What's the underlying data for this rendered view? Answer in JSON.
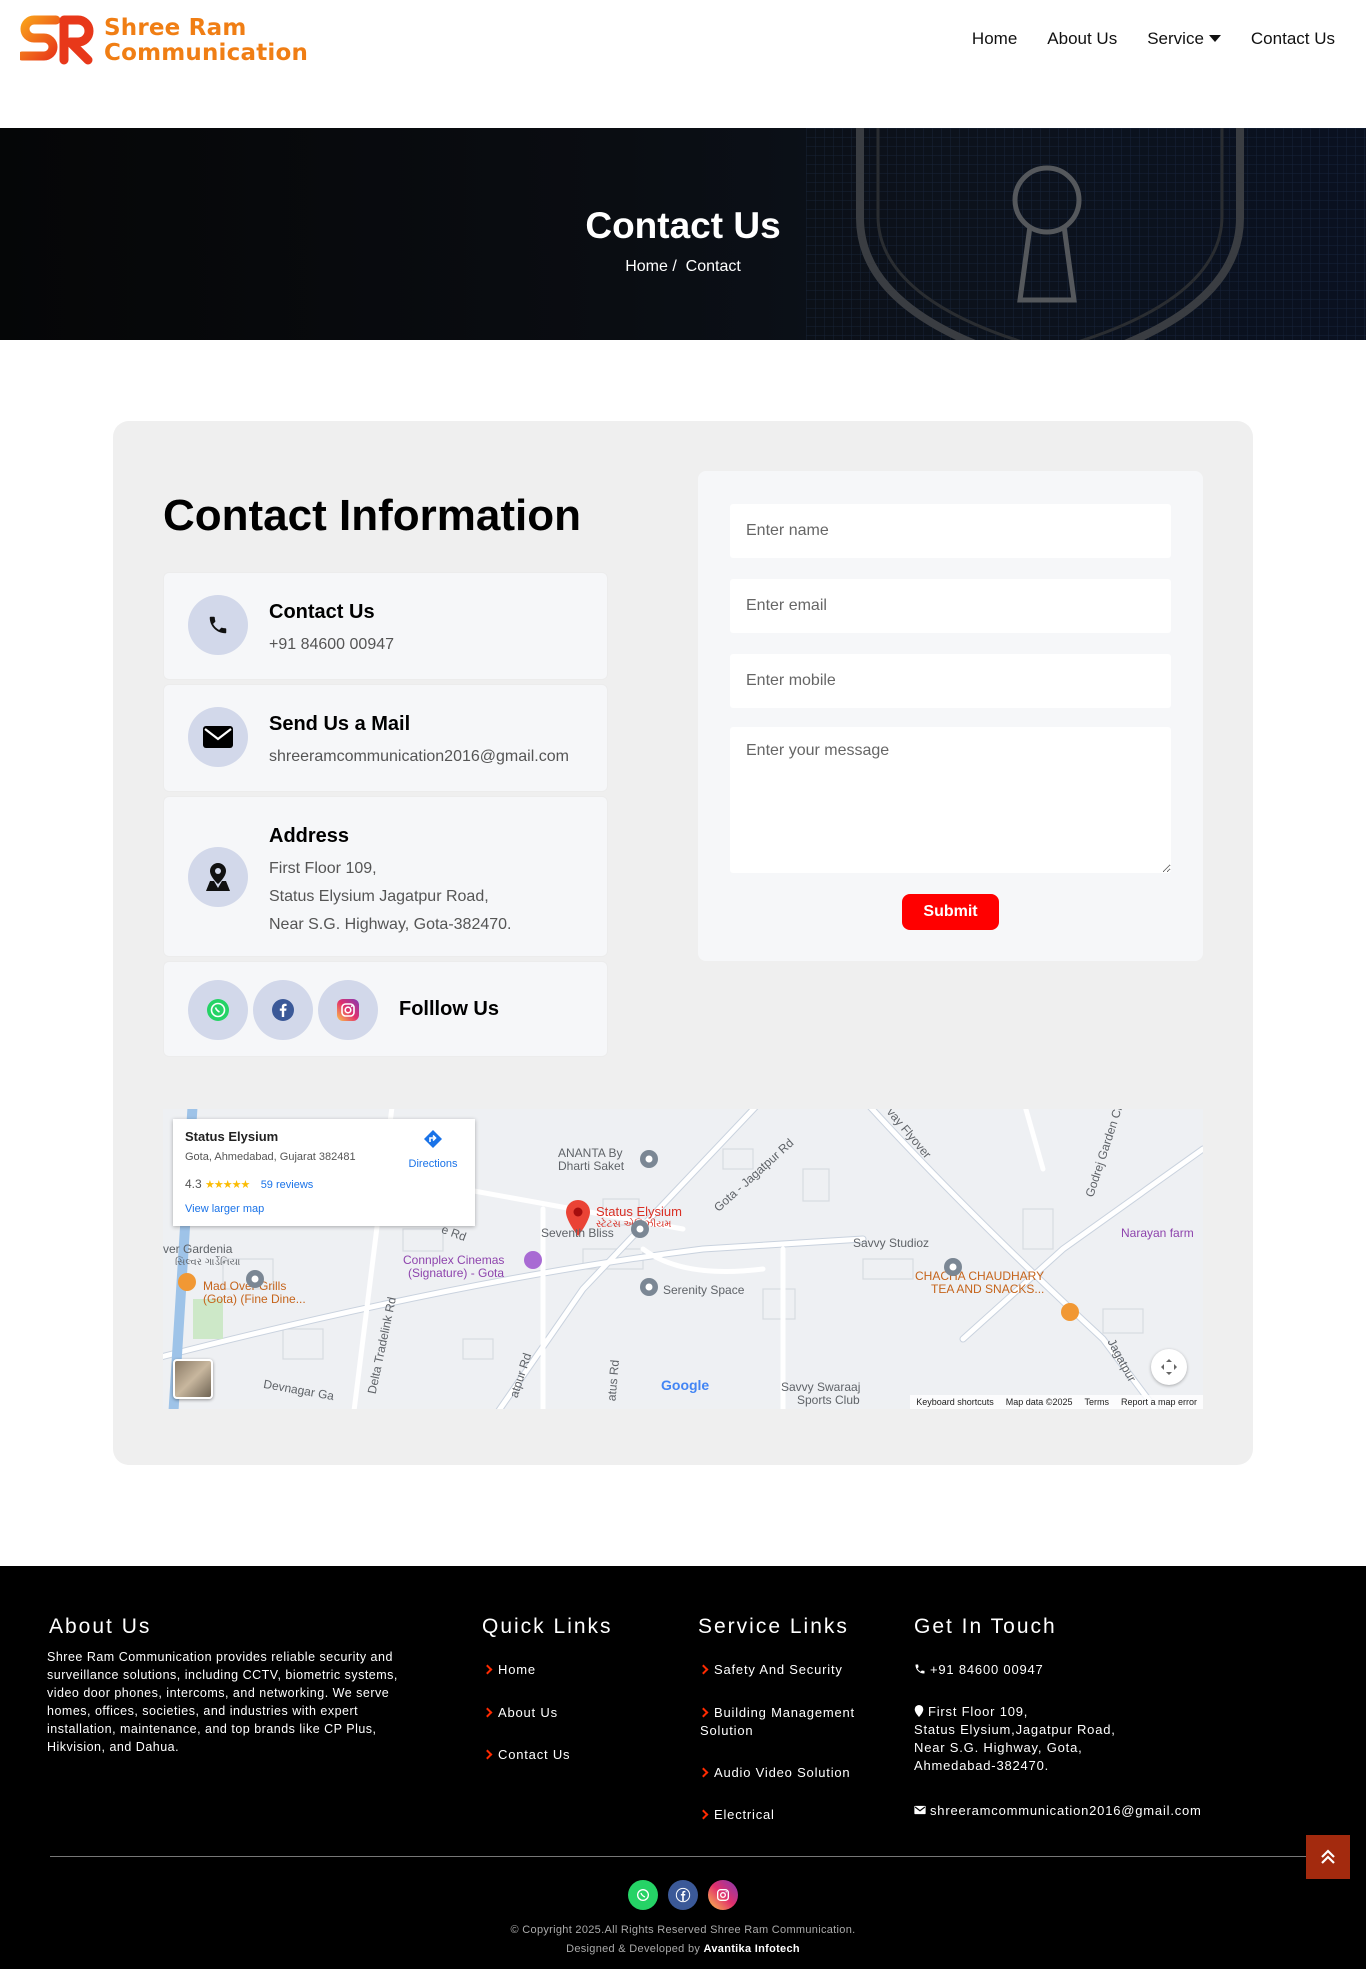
{
  "header": {
    "brand_line1": "Shree Ram",
    "brand_line2": "Communication",
    "nav": [
      "Home",
      "About Us",
      "Service",
      "Contact Us"
    ]
  },
  "banner": {
    "title": "Contact Us",
    "breadcrumb_home": "Home /",
    "breadcrumb_current": "Contact"
  },
  "contact": {
    "heading": "Contact Information",
    "phone_title": "Contact Us",
    "phone_value": "+91 84600 00947",
    "mail_title": "Send Us a Mail",
    "mail_value": "shreeramcommunication2016@gmail.com",
    "address_title": "Address",
    "address_line1": "First Floor 109,",
    "address_line2": "Status Elysium Jagatpur Road,",
    "address_line3": "Near S.G. Highway, Gota-382470.",
    "follow_label": "Folllow Us",
    "social_icons": [
      "whatsapp-icon",
      "facebook-icon",
      "instagram-icon"
    ]
  },
  "form": {
    "name_placeholder": "Enter name",
    "email_placeholder": "Enter email",
    "mobile_placeholder": "Enter mobile",
    "message_placeholder": "Enter your message",
    "submit_label": "Submit"
  },
  "map": {
    "place_name": "Status Elysium",
    "place_address": "Gota, Ahmedabad, Gujarat 382481",
    "rating": "4.3",
    "reviews": "59 reviews",
    "larger_map": "View larger map",
    "directions": "Directions",
    "pin_label": "Status Elysium",
    "pin_label_gu": "સ્ટેટસ એલિઝીયમ",
    "labels": {
      "ananta": "ANANTA By",
      "ananta2": "Dharti Saket",
      "seventh": "Seventh Bliss",
      "serenity": "Serenity Space",
      "savvy": "Savvy Studioz",
      "savvy_swaraaj": "Savvy Swaraaj",
      "sports_club": "Sports Club",
      "connplex": "Connplex Cinemas",
      "connplex2": "(Signature) - Gota",
      "mad_over": "Mad Over Grills",
      "mad_over2": "(Gota) (Fine Dine...",
      "chacha": "CHACHA CHAUDHARY",
      "chacha2": "TEA AND SNACKS...",
      "narayan": "Narayan farm",
      "gardenia": "ver Gardenia",
      "gardenia_gu": "સિલ્વર ગાર્ડેનિયા",
      "devnagar": "Devnagar Ga",
      "gota_jagatpur": "Gota - Jagatpur Rd",
      "godrej": "Godrej Garden Cit",
      "flyover": "vay Flyover",
      "delta": "Delta Tradelink Rd",
      "jagatpur": "Jagatpur",
      "rd_label": "e Rd",
      "atpur_rd": "atpur Rd",
      "atus_rd": "atus Rd"
    },
    "google": "Google",
    "footer_links": [
      "Keyboard shortcuts",
      "Map data ©2025",
      "Terms",
      "Report a map error"
    ]
  },
  "footer": {
    "about_heading": "About Us",
    "about_text": "Shree Ram Communication provides reliable security and surveillance solutions, including CCTV, biometric systems, video door phones, intercoms, and networking. We serve homes, offices, societies, and industries with expert installation, maintenance, and top brands like CP Plus, Hikvision, and Dahua.",
    "quick_heading": "Quick Links",
    "quick_links": [
      "Home",
      "About Us",
      "Contact Us"
    ],
    "service_heading": "Service Links",
    "service_links": [
      "Safety And Security",
      "Building Management",
      "Solution",
      "Audio Video Solution",
      "Electrical"
    ],
    "touch_heading": "Get In Touch",
    "phone": "+91 84600 00947",
    "address1": "First Floor 109,",
    "address2": "Status Elysium,Jagatpur Road,",
    "address3": "Near S.G. Highway, Gota,",
    "address4": "Ahmedabad-382470.",
    "email": "shreeramcommunication2016@gmail.com",
    "copyright": "© Copyright 2025.All Rights Reserved Shree Ram Communication.",
    "designed_prefix": "Designed & Developed by",
    "designed_by": "Avantika Infotech"
  },
  "colors": {
    "brand_orange": "#f07e14",
    "brand_red": "#ff2a00",
    "submit_red": "#ff0000",
    "icon_bg": "#d2d8ea"
  }
}
